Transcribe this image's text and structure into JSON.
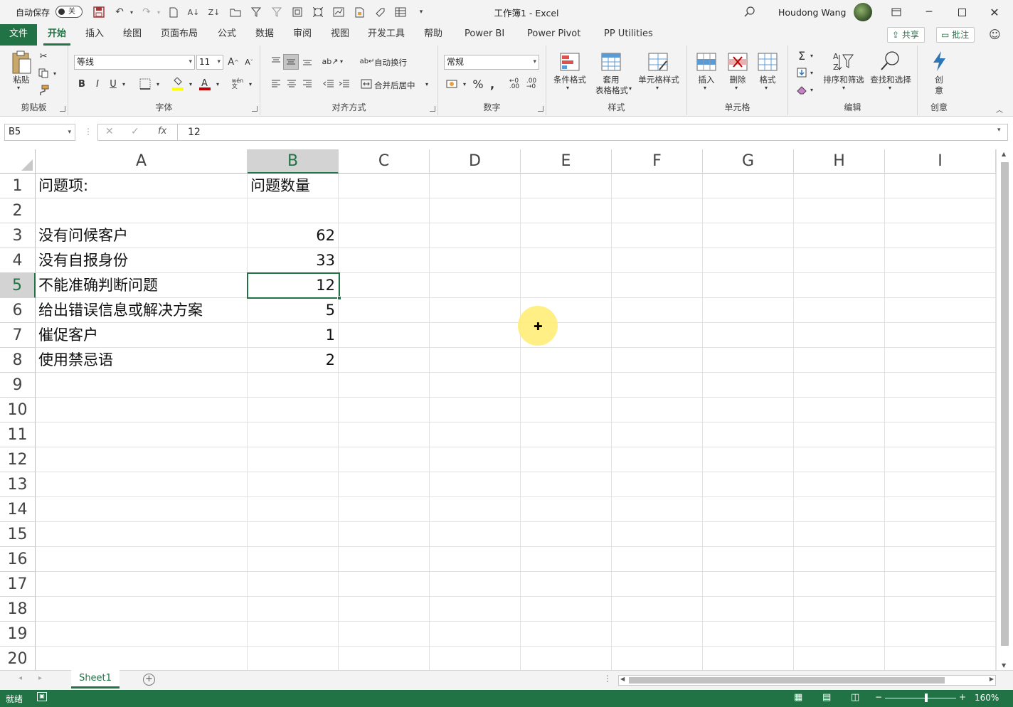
{
  "titlebar": {
    "autosave_label": "自动保存",
    "autosave_state": "关",
    "doc_title": "工作簿1 - Excel",
    "user_name": "Houdong Wang"
  },
  "tabs": [
    "文件",
    "开始",
    "插入",
    "绘图",
    "页面布局",
    "公式",
    "数据",
    "审阅",
    "视图",
    "开发工具",
    "帮助",
    "Power BI",
    "Power Pivot",
    "PP Utilities"
  ],
  "header_buttons": {
    "share": "共享",
    "comments": "批注"
  },
  "ribbon": {
    "clipboard": {
      "label": "剪贴板",
      "paste": "粘贴"
    },
    "font": {
      "label": "字体",
      "font_name": "等线",
      "font_size": "11"
    },
    "alignment": {
      "label": "对齐方式",
      "wrap_text": "自动换行",
      "merge_center": "合并后居中"
    },
    "number": {
      "label": "数字",
      "format": "常规"
    },
    "styles": {
      "label": "样式",
      "conditional": "条件格式",
      "table_format_1": "套用",
      "table_format_2": "表格格式",
      "cell_styles": "单元格样式"
    },
    "cells": {
      "label": "单元格",
      "insert": "插入",
      "delete": "删除",
      "format": "格式"
    },
    "editing": {
      "label": "编辑",
      "sort_filter": "排序和筛选",
      "find_select": "查找和选择"
    },
    "creativity": {
      "label": "创意",
      "ideas_1": "创",
      "ideas_2": "意"
    }
  },
  "formula_bar": {
    "name_box": "B5",
    "fx": "fx",
    "value": "12"
  },
  "columns": [
    "A",
    "B",
    "C",
    "D",
    "E",
    "F",
    "G",
    "H",
    "I"
  ],
  "rows": [
    "1",
    "2",
    "3",
    "4",
    "5",
    "6",
    "7",
    "8",
    "9",
    "10",
    "11",
    "12",
    "13",
    "14",
    "15",
    "16",
    "17",
    "18",
    "19",
    "20"
  ],
  "cells": {
    "A1": "问题项:",
    "B1": "问题数量",
    "A3": "没有问候客户",
    "B3": "62",
    "A4": "没有自报身份",
    "B4": "33",
    "A5": "不能准确判断问题",
    "B5": "12",
    "A6": "给出错误信息或解决方案",
    "B6": "5",
    "A7": "催促客户",
    "B7": "1",
    "A8": "使用禁忌语",
    "B8": "2"
  },
  "selected_cell": "B5",
  "sheet_tab": "Sheet1",
  "status": {
    "ready": "就绪",
    "zoom": "160%"
  },
  "colors": {
    "accent": "#217346"
  }
}
